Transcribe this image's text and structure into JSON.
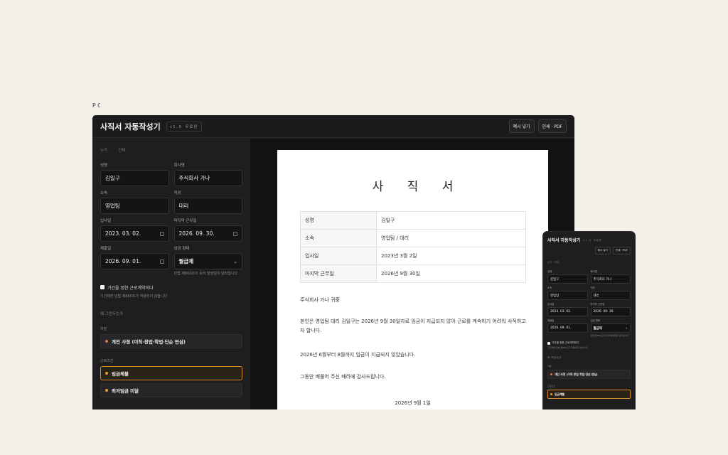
{
  "section_label": "PC",
  "app": {
    "title": "사직서 자동작성기",
    "version": "v1.0 무료판",
    "example_button": "예시 넣기",
    "print_button": "인쇄 · PDF"
  },
  "breadcrumb": [
    "누가",
    "·",
    "언제"
  ],
  "form": {
    "name_label": "성명",
    "name_value": "김일구",
    "company_label": "회사명",
    "company_value": "주식회사 가나",
    "dept_label": "소속",
    "dept_value": "영업팀",
    "position_label": "직위",
    "position_value": "대리",
    "hire_label": "입사일",
    "hire_value": "2023. 03. 02.",
    "lastday_label": "마지막 근무일",
    "lastday_value": "2026. 09. 30.",
    "submit_label": "제출일",
    "submit_value": "2026. 09. 01.",
    "pay_label": "임금 형태",
    "pay_value": "월급제",
    "pay_hint": "민법 제660조의 효력 발생일이 달라집니다",
    "fixed_term_label": "기간을 정한 근로계약이다",
    "fixed_term_hint": "기간제면 민법 제660조가 적용되지 않습니다",
    "reasons_head": "왜 그만두는가",
    "personal_group": "자발",
    "personal_reason": "개인 사정 (이직·창업·학업·단순 변심)",
    "condition_group": "근로조건",
    "reason_wage_arrears": "임금체불",
    "reason_min_wage": "최저임금 미달"
  },
  "document": {
    "title": "사 직 서",
    "rows": [
      {
        "k": "성명",
        "v": "김일구"
      },
      {
        "k": "소속",
        "v": "영업팀 / 대리"
      },
      {
        "k": "입사일",
        "v": "2023년 3월 2일"
      },
      {
        "k": "마지막 근무일",
        "v": "2026년 9월 30일"
      }
    ],
    "addressee": "주식회사 가나 귀중",
    "para1": "본인은 영업팀 대리 김일구는 2026년 9월 30일자로 임금이 지급되지 않아 근로를 계속하기 어려워 사직하고자 합니다.",
    "para2": "2026년 6월부터 8월까지 임금이 지급되지 않았습니다.",
    "para3": "그동안 베풀어 주신 배려에 감사드립니다.",
    "date": "2026년 9월 1일"
  },
  "mobile": {
    "version": "v1.0 무료판",
    "company_value": "주식회사 가나",
    "pay_hint": "민법 제660조의 효력 발생일이 달라집니다",
    "personal_reason": "개인 사정 (이직·창업·학업·단순 변심)"
  },
  "colors": {
    "accent": "#d98e2b",
    "dot_red": "#e0734f",
    "dot_amber": "#e6a233",
    "background": "#f3f0ea"
  }
}
